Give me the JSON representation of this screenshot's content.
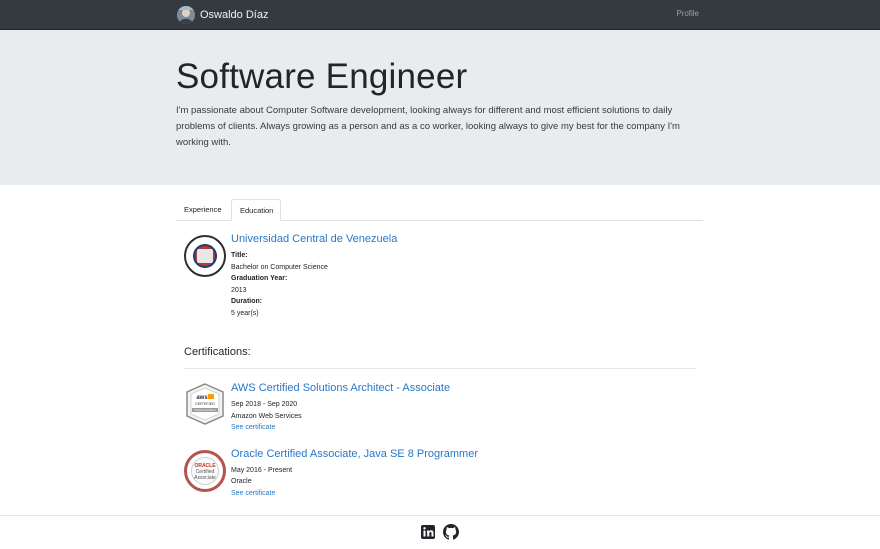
{
  "navbar": {
    "brand_name": "Oswaldo Díaz",
    "nav_profile": "Profile"
  },
  "hero": {
    "title": "Software Engineer",
    "description": "I'm passionate about Computer Software development, looking always for different and most efficient solutions to daily problems of clients. Always growing as a person and as a co worker, looking always to give my best for the company I'm working with."
  },
  "tabs": [
    {
      "label": "Experience",
      "active": false
    },
    {
      "label": "Education",
      "active": true
    }
  ],
  "education": {
    "school": "Universidad Central de Venezuela",
    "title_label": "Title:",
    "title_value": "Bachelor on Computer Science",
    "grad_label": "Graduation Year:",
    "grad_value": "2013",
    "duration_label": "Duration:",
    "duration_value": "5 year(s)"
  },
  "certifications": {
    "heading": "Certifications:",
    "items": [
      {
        "name": "AWS Certified Solutions Architect - Associate",
        "dates": "Sep 2018 - Sep 2020",
        "issuer": "Amazon Web Services",
        "link": "See certificate",
        "badge_text_top": "aws",
        "badge_text_mid": "CERTIFIED",
        "badge_text_bottom": "Solutions Architect"
      },
      {
        "name": "Oracle Certified Associate, Java SE 8 Programmer",
        "dates": "May 2016 - Present",
        "issuer": "Oracle",
        "link": "See certificate",
        "badge_text_top": "ORACLE",
        "badge_text_mid": "Certified",
        "badge_text_bottom": "Associate"
      }
    ]
  },
  "footer": {
    "icons": [
      "linkedin-icon",
      "github-icon"
    ]
  },
  "colors": {
    "navbar": "#343a40",
    "jumbotron": "#e9ecef",
    "link": "#2878c8"
  }
}
